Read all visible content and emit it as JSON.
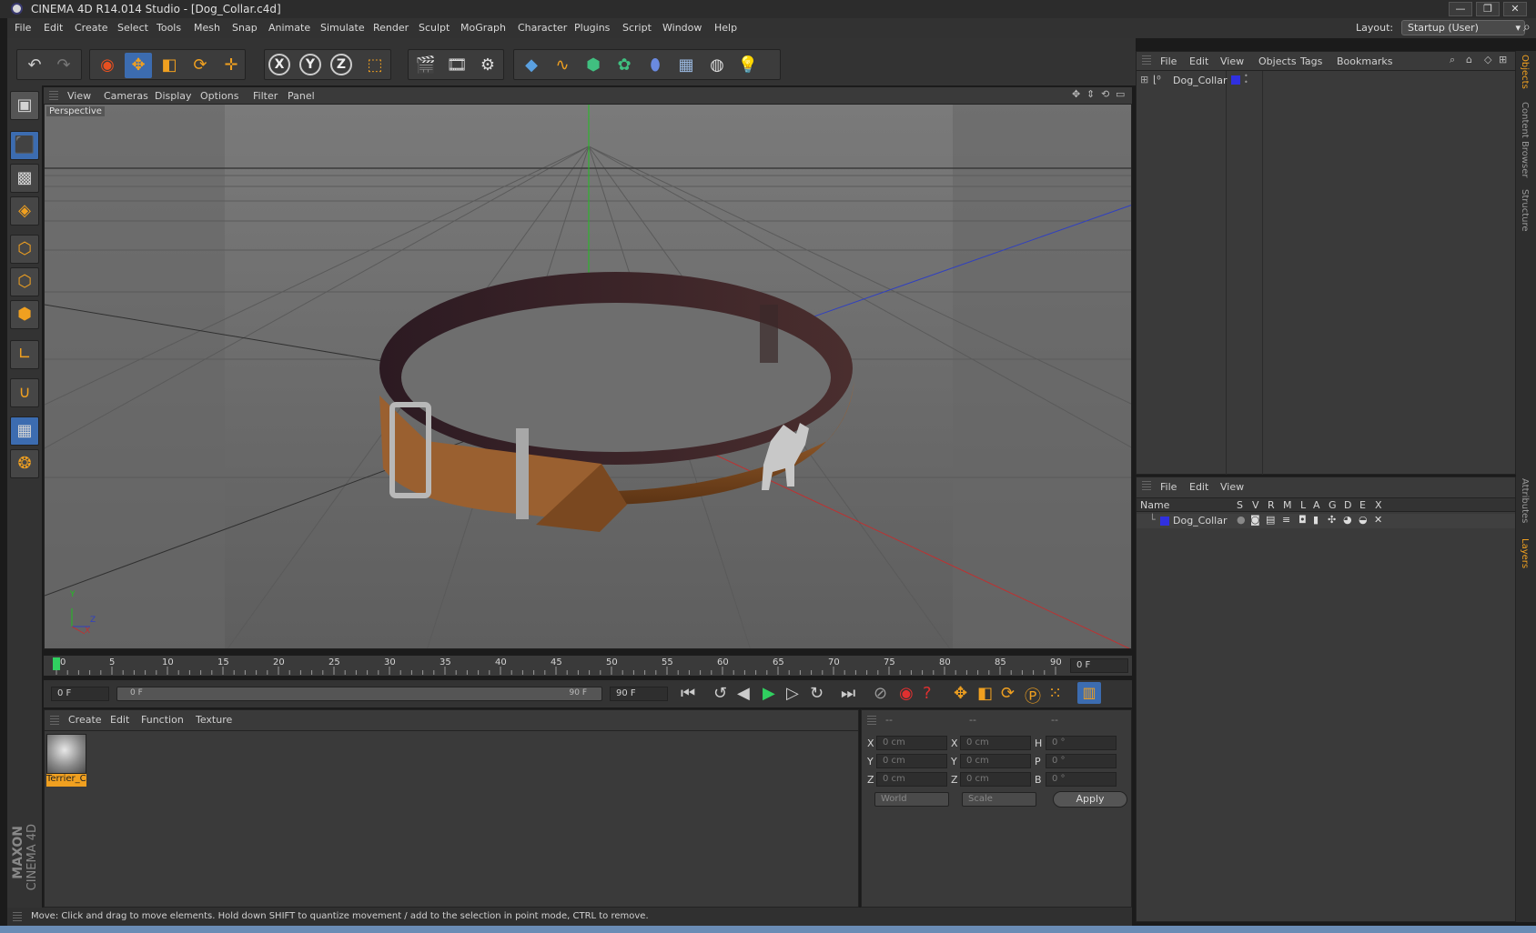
{
  "window": {
    "title": "CINEMA 4D R14.014 Studio - [Dog_Collar.c4d]",
    "minimize": "—",
    "restore": "❐",
    "close": "✕"
  },
  "menu": {
    "items": [
      "File",
      "Edit",
      "Create",
      "Select",
      "Tools",
      "Mesh",
      "Snap",
      "Animate",
      "Simulate",
      "Render",
      "Sculpt",
      "MoGraph",
      "Character",
      "Plugins",
      "Script",
      "Window",
      "Help"
    ],
    "layout_label": "Layout:",
    "layout_value": "Startup (User)"
  },
  "toolbar": {
    "axis_x": "X",
    "axis_y": "Y",
    "axis_z": "Z"
  },
  "viewport": {
    "menu": [
      "View",
      "Cameras",
      "Display",
      "Options",
      "Filter",
      "Panel"
    ],
    "label": "Perspective",
    "axis_y": "Y",
    "axis_z": "Z",
    "axis_x": "X"
  },
  "timeline": {
    "ticks": [
      "0",
      "5",
      "10",
      "15",
      "20",
      "25",
      "30",
      "35",
      "40",
      "45",
      "50",
      "55",
      "60",
      "65",
      "70",
      "75",
      "80",
      "85",
      "90"
    ],
    "current_frame": "0 F",
    "start_frame": "0 F",
    "range_start": "0 F",
    "range_end": "90 F",
    "end_frame": "90 F"
  },
  "materials": {
    "menu": [
      "Create",
      "Edit",
      "Function",
      "Texture"
    ],
    "material_name": "Terrier_C"
  },
  "coords": {
    "headers": [
      "--",
      "--",
      "--"
    ],
    "pos_labels": [
      "X",
      "Y",
      "Z"
    ],
    "pos_values": [
      "0 cm",
      "0 cm",
      "0 cm"
    ],
    "size_labels": [
      "X",
      "Y",
      "Z"
    ],
    "size_values": [
      "0 cm",
      "0 cm",
      "0 cm"
    ],
    "rot_labels": [
      "H",
      "P",
      "B"
    ],
    "rot_values": [
      "0 °",
      "0 °",
      "0 °"
    ],
    "world": "World",
    "scale": "Scale",
    "apply": "Apply"
  },
  "objects": {
    "menu": [
      "File",
      "Edit",
      "View",
      "Objects",
      "Tags",
      "Bookmarks"
    ],
    "item": "Dog_Collar"
  },
  "layers": {
    "menu": [
      "File",
      "Edit",
      "View"
    ],
    "col_name": "Name",
    "cols": [
      "S",
      "V",
      "R",
      "M",
      "L",
      "A",
      "G",
      "D",
      "E",
      "X"
    ],
    "item": "Dog_Collar"
  },
  "side_tabs": [
    "Objects",
    "Content Browser",
    "Structure",
    "Attributes",
    "Layers"
  ],
  "brand": {
    "maxon": "MAXON",
    "product": "CINEMA 4D"
  },
  "status": "Move: Click and drag to move elements. Hold down SHIFT to quantize movement / add to the selection in point mode, CTRL to remove.",
  "colors": {
    "accent": "#f0a020",
    "layer_color": "#3030e0",
    "active_blue": "#3c6cb0"
  }
}
